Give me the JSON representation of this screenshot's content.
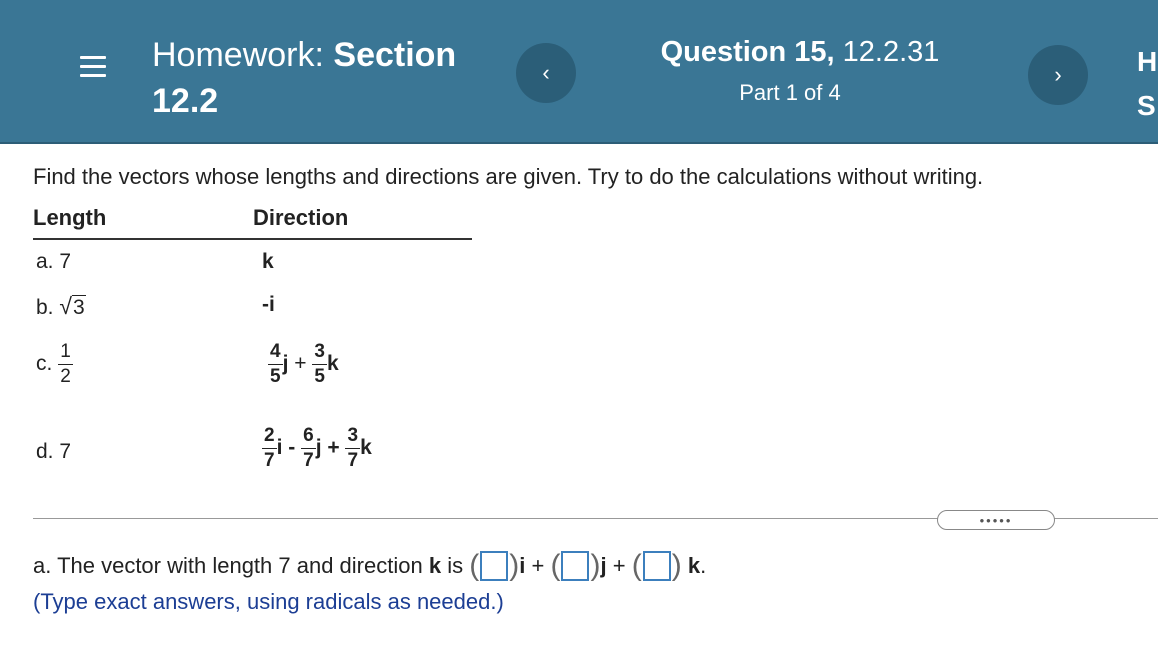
{
  "header": {
    "hw_prefix": "Homework:",
    "hw_section": "Section",
    "hw_section_num": "12.2",
    "question_label": "Question 15,",
    "question_ref": "12.2.31",
    "part": "Part 1 of 4",
    "prev_glyph": "‹",
    "next_glyph": "›",
    "hs_top": "H",
    "hs_bottom": "S"
  },
  "instruction": "Find the vectors whose lengths and directions are given. Try to do the calculations without writing.",
  "table": {
    "col_length": "Length",
    "col_direction": "Direction",
    "rows": [
      {
        "label": "a.",
        "length": "7",
        "direction": "k"
      },
      {
        "label": "b.",
        "length_sqrt_symbol": "√",
        "length_radicand": "3",
        "direction": "-i"
      },
      {
        "label": "c.",
        "length_num": "1",
        "length_den": "2",
        "dir_num1": "4",
        "dir_den1": "5",
        "dir_v1": "j",
        "op1": "+",
        "dir_num2": "3",
        "dir_den2": "5",
        "dir_v2": "k"
      },
      {
        "label": "d.",
        "length": "7",
        "dir_num1": "2",
        "dir_den1": "7",
        "dir_v1": "i",
        "op1": "-",
        "dir_num2": "6",
        "dir_den2": "7",
        "dir_v2": "j",
        "op2": "+",
        "dir_num3": "3",
        "dir_den3": "7",
        "dir_v3": "k"
      }
    ]
  },
  "more_glyph": "•••••",
  "answer": {
    "prefix": "a. The vector with length 7 and direction",
    "dir": "k",
    "is": "is",
    "open_paren": "(",
    "close_paren": ")",
    "i": "i",
    "j": "j",
    "k": "k",
    "plus": "+",
    "period": "."
  },
  "hint": "(Type exact answers, using radicals as needed.)",
  "colors": {
    "header_bg": "#3a7695",
    "nav_button": "#2b5e78",
    "hint_text": "#1c3e94",
    "answer_box": "#3c7fbd"
  }
}
